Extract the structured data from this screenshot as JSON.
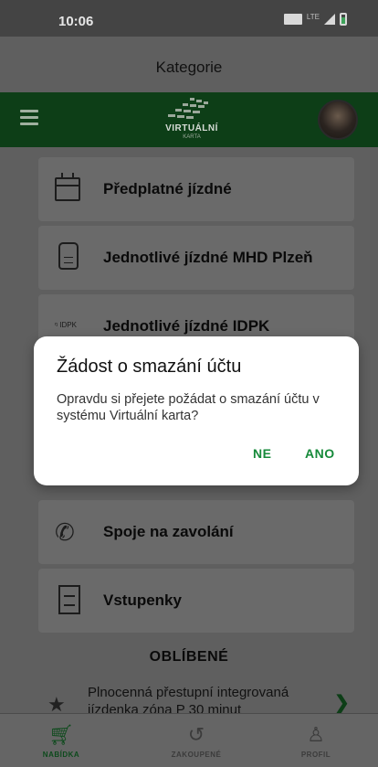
{
  "status_bar": {
    "time": "10:06",
    "network": "LTE"
  },
  "page": {
    "title": "Kategorie"
  },
  "header": {
    "logo_text": "VIRTUÁLNÍ",
    "logo_sub": "KARTA"
  },
  "menu_cards": [
    {
      "label": "Předplatné jízdné",
      "icon": "calendar-icon"
    },
    {
      "label": "Jednotlivé jízdné MHD Plzeň",
      "icon": "sim-card-icon"
    },
    {
      "label": "Jednotlivé jízdné IDPK",
      "icon": "idpk-logo-icon",
      "icon_text": "IDPK"
    },
    {
      "label": "Spoje na zavolání",
      "icon": "phone-icon"
    },
    {
      "label": "Vstupenky",
      "icon": "ticket-icon"
    }
  ],
  "favorites": {
    "heading": "OBLÍBENÉ",
    "items": [
      {
        "text": "Plnocenná přestupní integrovaná jízdenka zóna P 30 minut"
      }
    ]
  },
  "bottom_nav": [
    {
      "label": "NABÍDKA",
      "icon": "cart-icon",
      "active": true
    },
    {
      "label": "ZAKOUPENÉ",
      "icon": "history-icon",
      "active": false
    },
    {
      "label": "PROFIL",
      "icon": "person-icon",
      "active": false
    }
  ],
  "dialog": {
    "title": "Žádost o smazání účtu",
    "message": "Opravdu si přejete požádat o smazání účtu v systému Virtuální karta?",
    "cancel_label": "NE",
    "confirm_label": "ANO"
  },
  "colors": {
    "header_bg": "#0d3e17",
    "accent": "#168a3a",
    "overlay": "#5f5f5f"
  }
}
